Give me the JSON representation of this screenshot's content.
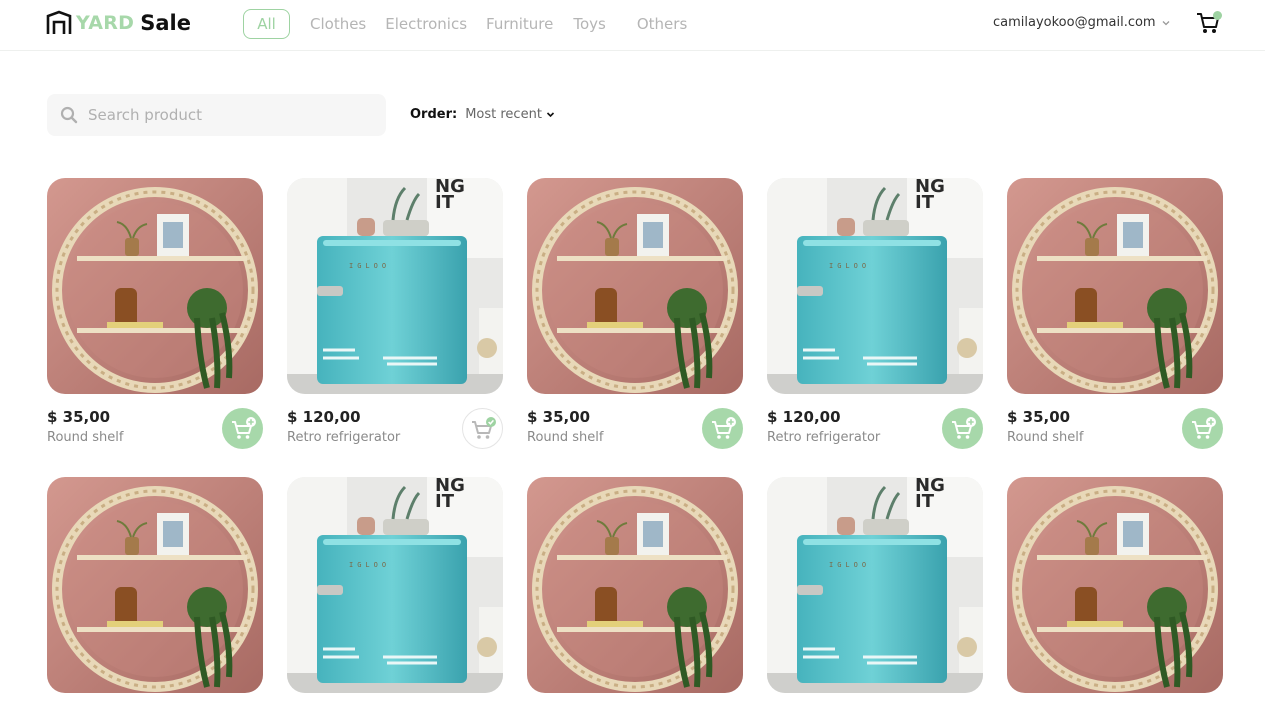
{
  "brand": {
    "logo_accent": "YARD",
    "logo_main": "Sale"
  },
  "nav": {
    "items": [
      {
        "label": "All",
        "active": true
      },
      {
        "label": "Clothes"
      },
      {
        "label": "Electronics"
      },
      {
        "label": "Furniture"
      },
      {
        "label": "Toys"
      },
      {
        "label": "Others"
      }
    ]
  },
  "account": {
    "email": "camilayokoo@gmail.com"
  },
  "search": {
    "placeholder": "Search product",
    "value": ""
  },
  "order": {
    "label": "Order:",
    "value": "Most recent"
  },
  "colors": {
    "accent": "#9ed3a2",
    "text": "#222222",
    "muted": "#8a8a8a",
    "search_bg": "#f6f6f6"
  },
  "products": [
    {
      "price": "$ 35,00",
      "name": "Round shelf",
      "image": "round-shelf",
      "in_cart": false
    },
    {
      "price": "$ 120,00",
      "name": "Retro refrigerator",
      "image": "retro-fridge",
      "in_cart": true
    },
    {
      "price": "$ 35,00",
      "name": "Round shelf",
      "image": "round-shelf",
      "in_cart": false
    },
    {
      "price": "$ 120,00",
      "name": "Retro refrigerator",
      "image": "retro-fridge",
      "in_cart": false
    },
    {
      "price": "$ 35,00",
      "name": "Round shelf",
      "image": "round-shelf",
      "in_cart": false
    },
    {
      "image": "round-shelf"
    },
    {
      "image": "retro-fridge"
    },
    {
      "image": "round-shelf"
    },
    {
      "image": "retro-fridge"
    },
    {
      "image": "round-shelf"
    }
  ]
}
